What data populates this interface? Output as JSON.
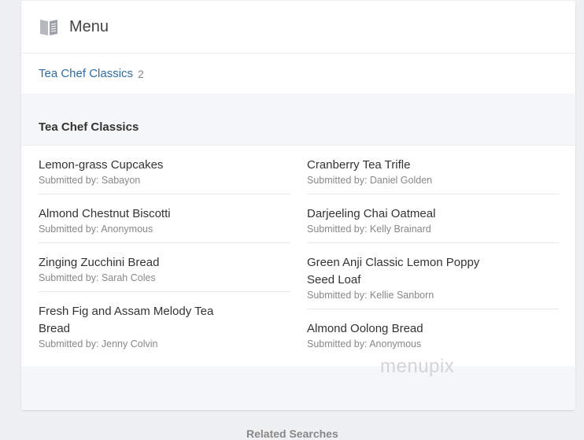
{
  "header": {
    "title": "Menu",
    "icon": "book-icon"
  },
  "category_link": {
    "label": "Tea Chef Classics",
    "count": "2"
  },
  "section": {
    "title": "Tea Chef Classics"
  },
  "items_left": [
    {
      "name": "Lemon-grass Cupcakes",
      "submitted": "Submitted by: Sabayon"
    },
    {
      "name": "Almond Chestnut Biscotti",
      "submitted": "Submitted by: Anonymous"
    },
    {
      "name": "Zinging Zucchini Bread",
      "submitted": "Submitted by: Sarah Coles"
    },
    {
      "name": "Fresh Fig and Assam Melody Tea Bread",
      "submitted": "Submitted by: Jenny Colvin"
    }
  ],
  "items_right": [
    {
      "name": "Cranberry Tea Trifle",
      "submitted": "Submitted by: Daniel Golden"
    },
    {
      "name": "Darjeeling Chai Oatmeal",
      "submitted": "Submitted by: Kelly Brainard"
    },
    {
      "name": "Green Anji Classic Lemon Poppy Seed Loaf",
      "submitted": "Submitted by: Kellie Sanborn"
    },
    {
      "name": "Almond Oolong Bread",
      "submitted": "Submitted by: Anonymous"
    }
  ],
  "watermark": "menupix",
  "related_heading": "Related Searches",
  "colors": {
    "link": "#2d6da6",
    "background": "#eff0f2",
    "band": "#f5f6f7"
  }
}
